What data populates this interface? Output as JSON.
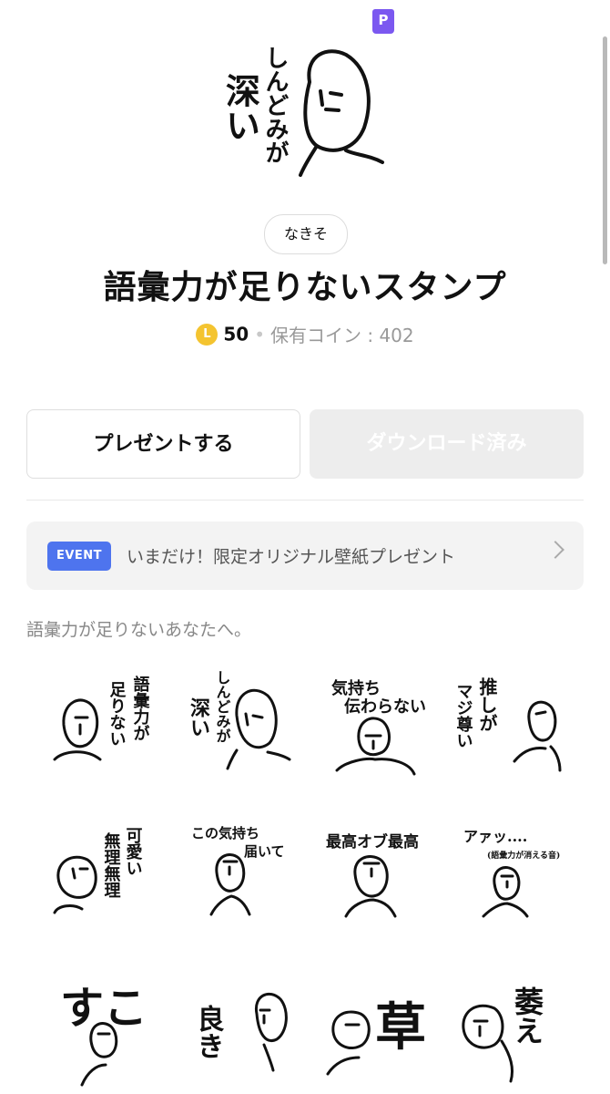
{
  "header": {
    "premium_badge": "P"
  },
  "main_sticker": {
    "line1": "しんどみが",
    "line2": "深い"
  },
  "creator": "なきそ",
  "title": "語彙力が足りないスタンプ",
  "price": {
    "coin_letter": "L",
    "amount": "50",
    "separator": "•",
    "owned_label": "保有コイン : 402"
  },
  "buttons": {
    "gift": "プレゼントする",
    "download": "ダウンロード済み"
  },
  "event": {
    "badge": "EVENT",
    "text": "いまだけ！限定オリジナル壁紙プレゼント"
  },
  "description": "語彙力が足りないあなたへ。",
  "stickers": {
    "s1": {
      "a": "語彙力が",
      "b": "足りない"
    },
    "s2": {
      "a": "しんどみが",
      "b": "深い"
    },
    "s3": {
      "a": "気持ち",
      "b": "伝わらない"
    },
    "s4": {
      "a": "推しが",
      "b": "マジ尊い"
    },
    "s5": {
      "a": "可愛い",
      "b": "無理無理"
    },
    "s6": {
      "a": "この気持ち",
      "b": "届いて"
    },
    "s7": {
      "a": "最高オブ最高"
    },
    "s8": {
      "a": "アァッ....",
      "b": "(語彙力が消える音)"
    },
    "s9": {
      "a": "すこ"
    },
    "s10": {
      "a": "良き"
    },
    "s11": {
      "a": "草"
    },
    "s12": {
      "a": "萎え"
    }
  },
  "colors": {
    "premium": "#7b58f0",
    "event_badge": "#4e74ee",
    "coin": "#f4c430"
  }
}
